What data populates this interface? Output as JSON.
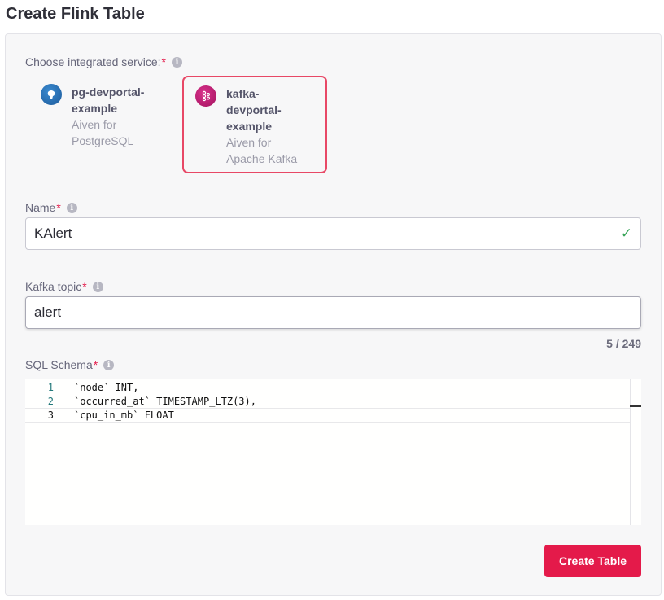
{
  "page": {
    "title": "Create Flink Table"
  },
  "service_picker": {
    "label": "Choose integrated service:",
    "required_mark": "*",
    "services": [
      {
        "name": "pg-devportal-example",
        "type": "Aiven for PostgreSQL",
        "icon": "postgresql-elephant-icon",
        "selected": false
      },
      {
        "name": "kafka-devportal-example",
        "type": "Aiven for Apache Kafka",
        "icon": "kafka-icon",
        "selected": true
      }
    ]
  },
  "name_field": {
    "label": "Name",
    "required_mark": "*",
    "value": "KAlert",
    "valid": true
  },
  "topic_field": {
    "label": "Kafka topic",
    "required_mark": "*",
    "value": "alert",
    "counter": "5 / 249"
  },
  "schema_field": {
    "label": "SQL Schema",
    "required_mark": "*",
    "lines": [
      {
        "num": "1",
        "code": "`node` INT,"
      },
      {
        "num": "2",
        "code": "`occurred_at` TIMESTAMP_LTZ(3),"
      },
      {
        "num": "3",
        "code": "`cpu_in_mb` FLOAT"
      }
    ],
    "active_line": 3
  },
  "actions": {
    "create_label": "Create Table"
  },
  "colors": {
    "accent": "#e41a4a",
    "selected_border": "#e84866",
    "valid_check": "#3aa55a"
  }
}
